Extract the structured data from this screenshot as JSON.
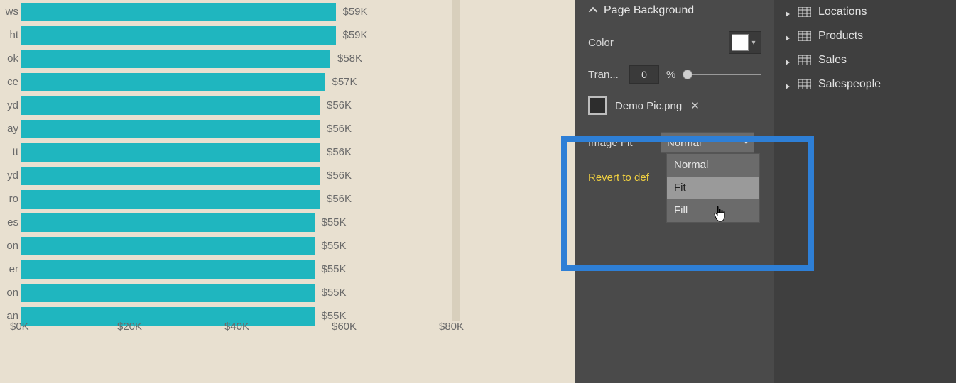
{
  "chart_data": {
    "type": "bar",
    "orientation": "horizontal",
    "categories": [
      "ws",
      "ht",
      "ok",
      "ce",
      "yd",
      "ay",
      "tt",
      "yd",
      "ro",
      "es",
      "on",
      "er",
      "on",
      "an"
    ],
    "values": [
      59,
      59,
      58,
      57,
      56,
      56,
      56,
      56,
      56,
      55,
      55,
      55,
      55,
      55
    ],
    "value_labels": [
      "$59K",
      "$59K",
      "$58K",
      "$57K",
      "$56K",
      "$56K",
      "$56K",
      "$56K",
      "$56K",
      "$55K",
      "$55K",
      "$55K",
      "$55K",
      "$55K"
    ],
    "xticks": [
      "$0K",
      "$20K",
      "$40K",
      "$60K",
      "$80K"
    ],
    "xlim": [
      0,
      80
    ],
    "bar_color": "#1fb6bf"
  },
  "format_panel": {
    "section": "Page Background",
    "color_label": "Color",
    "color_value": "#ffffff",
    "transparency_label": "Tran...",
    "transparency_value": "0",
    "transparency_unit": "%",
    "image_file": "Demo Pic.png",
    "image_fit_label": "Image Fit",
    "image_fit_selected": "Normal",
    "image_fit_options": [
      "Normal",
      "Fit",
      "Fill"
    ],
    "revert_label": "Revert to def"
  },
  "fields_panel": {
    "tables": [
      "Locations",
      "Products",
      "Sales",
      "Salespeople"
    ]
  }
}
